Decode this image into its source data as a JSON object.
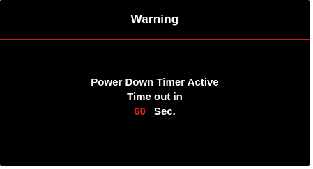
{
  "dialog": {
    "title": "Warning",
    "message_line1": "Power Down Timer Active",
    "message_line2": "Time out in",
    "countdown_value": "60",
    "countdown_unit": "Sec."
  },
  "colors": {
    "background": "#000000",
    "text": "#ffffff",
    "accent": "#e31e1e",
    "divider": "#c81e1e"
  }
}
